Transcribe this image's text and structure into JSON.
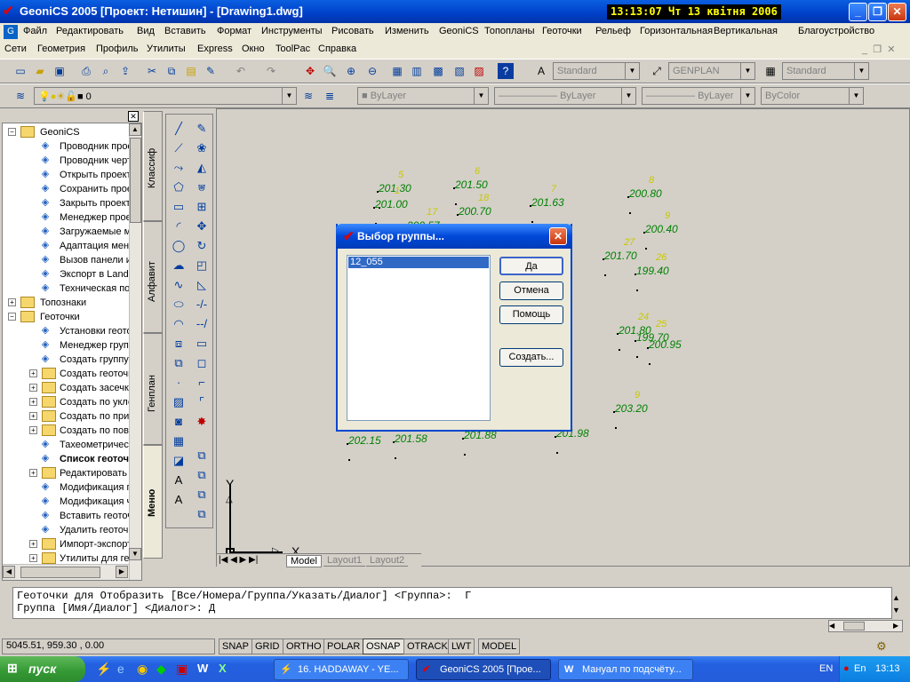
{
  "window": {
    "title": "GeoniCS 2005 [Проект: Нетишин] - [Drawing1.dwg]",
    "clock": "13:13:07  Чт 13 квітня 2006"
  },
  "menu1": [
    "Файл",
    "Редактировать",
    "Вид",
    "Вставить",
    "Формат",
    "Инструменты",
    "Рисовать",
    "Изменить",
    "GeoniCS",
    "Топопланы",
    "Геоточки",
    "Рельеф",
    "Горизонтальная",
    "Вертикальная",
    "Благоустройство"
  ],
  "menu2": [
    "Сети",
    "Геометрия",
    "Профиль",
    "Утилиты",
    "Express",
    "Окно",
    "ToolPac",
    "Справка"
  ],
  "toolbar": {
    "text_style": "Standard",
    "dim_style": "GENPLAN",
    "table_style": "Standard",
    "layer": "0",
    "color": "ByLayer",
    "linetype": "ByLayer",
    "lineweight": "ByLayer",
    "plotstyle": "ByColor"
  },
  "tree": {
    "items": [
      {
        "label": "GeoniCS",
        "level": 0,
        "exp": "−"
      },
      {
        "label": "Проводник проекта",
        "level": 1
      },
      {
        "label": "Проводник чертежа",
        "level": 1
      },
      {
        "label": "Открыть проект",
        "level": 1
      },
      {
        "label": "Сохранить проект",
        "level": 1
      },
      {
        "label": "Закрыть проект",
        "level": 1
      },
      {
        "label": "Менеджер проекта",
        "level": 1
      },
      {
        "label": "Загружаемые модули",
        "level": 1
      },
      {
        "label": "Адаптация меню",
        "level": 1
      },
      {
        "label": "Вызов панели инструментов",
        "level": 1
      },
      {
        "label": "Экспорт в LandXML",
        "level": 1
      },
      {
        "label": "Техническая поддержка",
        "level": 1
      },
      {
        "label": "Топознаки",
        "level": 0,
        "exp": "+"
      },
      {
        "label": "Геоточки",
        "level": 0,
        "exp": "−"
      },
      {
        "label": "Установки геоточек",
        "level": 1
      },
      {
        "label": "Менеджер групп",
        "level": 1
      },
      {
        "label": "Создать группу",
        "level": 1
      },
      {
        "label": "Создать геоточки",
        "level": 1,
        "exp": "+"
      },
      {
        "label": "Создать засечками",
        "level": 1,
        "exp": "+"
      },
      {
        "label": "Создать по уклону",
        "level": 1,
        "exp": "+"
      },
      {
        "label": "Создать по примитивам",
        "level": 1,
        "exp": "+"
      },
      {
        "label": "Создать по поверхности",
        "level": 1,
        "exp": "+"
      },
      {
        "label": "Тахеометрическая съемка",
        "level": 1
      },
      {
        "label": "Список геоточек",
        "level": 1,
        "bold": true
      },
      {
        "label": "Редактировать",
        "level": 1,
        "exp": "+"
      },
      {
        "label": "Модификация геоточек",
        "level": 1
      },
      {
        "label": "Модификация чертежа",
        "level": 1
      },
      {
        "label": "Вставить геоточки",
        "level": 1
      },
      {
        "label": "Удалить геоточки",
        "level": 1
      },
      {
        "label": "Импорт-экспорт",
        "level": 1,
        "exp": "+"
      },
      {
        "label": "Утилиты для геоточек",
        "level": 1,
        "exp": "+"
      }
    ]
  },
  "tabs": [
    "Классиф",
    "Алфавит",
    "Генплан",
    "Меню"
  ],
  "drawing": {
    "points": [
      {
        "n": "5",
        "e": "201.30"
      },
      {
        "n": "6",
        "e": "201.50"
      },
      {
        "n": "8",
        "e": "200.80"
      },
      {
        "n": "1",
        "e": "201.00"
      },
      {
        "n": "18",
        "e": "200.70"
      },
      {
        "n": "7",
        "e": "201.63"
      },
      {
        "n": "9",
        "e": "200.40"
      },
      {
        "n": "27",
        "e": "201.70"
      },
      {
        "n": "26",
        "e": "199.40"
      },
      {
        "n": "24",
        "e": "201.80"
      },
      {
        "n": "25",
        "e": "199.70"
      },
      {
        "n": "",
        "e": "200.95"
      },
      {
        "n": "9",
        "e": "203.20"
      },
      {
        "n": "",
        "e": "202.15"
      },
      {
        "n": "",
        "e": "201.58"
      },
      {
        "n": "",
        "e": "201.88"
      },
      {
        "n": "",
        "e": "201.98"
      },
      {
        "n": "17",
        "e": "200.57"
      }
    ],
    "axis_x": "X",
    "axis_y": "Y",
    "layout_tabs": [
      "Model",
      "Layout1",
      "Layout2"
    ]
  },
  "dialog": {
    "title": "Выбор группы...",
    "list": [
      "12_055"
    ],
    "ok": "Да",
    "cancel": "Отмена",
    "help": "Помощь",
    "create": "Создать..."
  },
  "command": {
    "line1": "Геоточки для Отобразить [Все/Номера/Группа/Указать/Диалог] <Группа>:  Г",
    "line2": "Группа [Имя/Диалог] <Диалог>: Д"
  },
  "status": {
    "coords": "5045.51, 959.30 , 0.00",
    "buttons": [
      "SNAP",
      "GRID",
      "ORTHO",
      "POLAR",
      "OSNAP",
      "OTRACK",
      "LWT",
      "MODEL"
    ]
  },
  "taskbar": {
    "start": "пуск",
    "tasks": [
      "16. HADDAWAY - YE...",
      "GeoniCS 2005 [Прое...",
      "Мануал по подсчёту..."
    ],
    "lang1": "EN",
    "lang2": "En",
    "time": "13:13"
  }
}
